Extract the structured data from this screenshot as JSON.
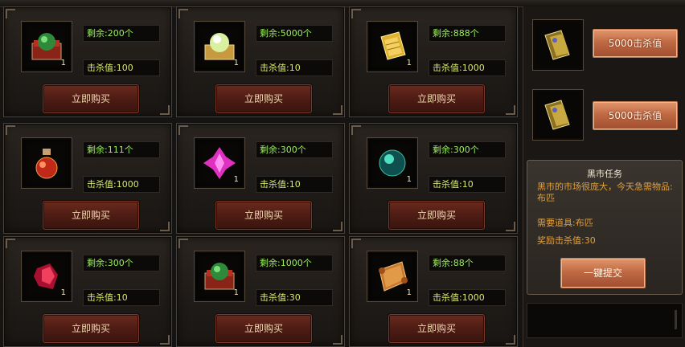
{
  "shop": {
    "items": [
      {
        "icon": "red-box-green-orb-icon",
        "qty": "1",
        "stock": "剩余:200个",
        "kill": "击杀值:100",
        "buy": "立即购买"
      },
      {
        "icon": "glowing-orb-box-icon",
        "qty": "1",
        "stock": "剩余:5000个",
        "kill": "击杀值:10",
        "buy": "立即购买"
      },
      {
        "icon": "golden-ticket-icon",
        "qty": "1",
        "stock": "剩余:888个",
        "kill": "击杀值:1000",
        "buy": "立即购买"
      },
      {
        "icon": "red-potion-icon",
        "qty": "",
        "stock": "剩余:111个",
        "kill": "击杀值:1000",
        "buy": "立即购买"
      },
      {
        "icon": "pink-crystal-icon",
        "qty": "1",
        "stock": "剩余:300个",
        "kill": "击杀值:10",
        "buy": "立即购买"
      },
      {
        "icon": "teal-orb-icon",
        "qty": "1",
        "stock": "剩余:300个",
        "kill": "击杀值:10",
        "buy": "立即购买"
      },
      {
        "icon": "red-gem-icon",
        "qty": "1",
        "stock": "剩余:300个",
        "kill": "击杀值:10",
        "buy": "立即购买"
      },
      {
        "icon": "red-box-green-orb-icon",
        "qty": "1",
        "stock": "剩余:1000个",
        "kill": "击杀值:30",
        "buy": "立即购买"
      },
      {
        "icon": "scroll-icon",
        "qty": "1",
        "stock": "剩余:88个",
        "kill": "击杀值:1000",
        "buy": "立即购买"
      }
    ]
  },
  "sidebar": {
    "offers": [
      {
        "icon": "golden-card-icon",
        "label": "5000击杀值"
      },
      {
        "icon": "golden-card-icon",
        "label": "5000击杀值"
      }
    ],
    "quest": {
      "title": "黑市任务",
      "desc": "黑市的市场很庞大，今天急需物品:布匹",
      "req": "需要道具:布匹",
      "reward": "奖励击杀值:30",
      "submit": "一键提交"
    }
  },
  "colors": {
    "stock": "#9cf05a",
    "kill": "#d8e86a",
    "quest_text": "#e0a040",
    "button": "#5a2218"
  }
}
